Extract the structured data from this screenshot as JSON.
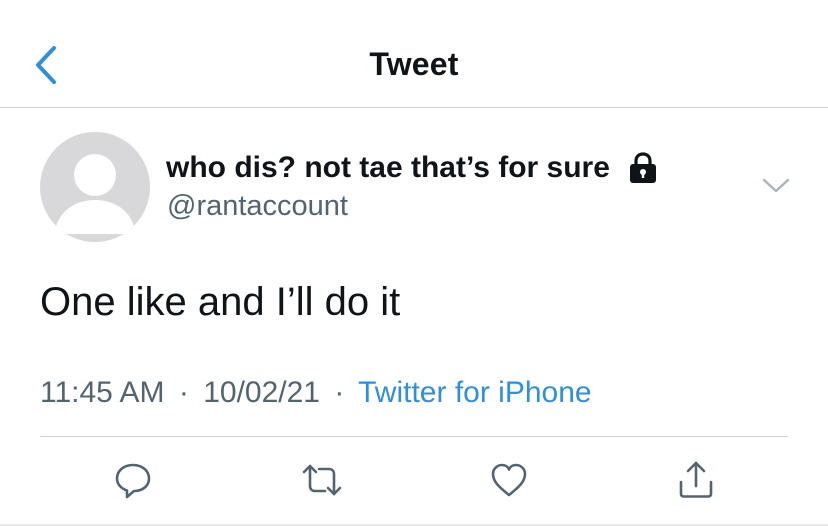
{
  "header": {
    "title": "Tweet",
    "back_icon": "chevron-left-icon",
    "accent_color": "#2f8fdb"
  },
  "tweet": {
    "author": {
      "display_name": "who dis? not tae that’s for sure",
      "handle": "@rantaccount",
      "protected_icon": "lock-icon",
      "avatar": "default-avatar-placeholder"
    },
    "text": "One like and I’ll do it",
    "time": "11:45 AM",
    "date": "10/02/21",
    "separator": "·",
    "source": "Twitter for iPhone"
  },
  "actions": {
    "reply_icon": "reply-icon",
    "retweet_icon": "retweet-icon",
    "like_icon": "heart-icon",
    "share_icon": "share-icon"
  }
}
